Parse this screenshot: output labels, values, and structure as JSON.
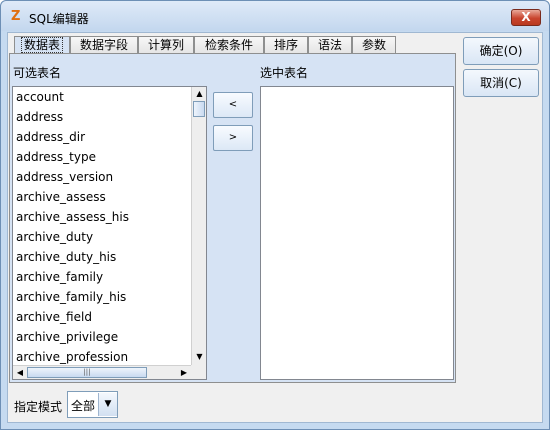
{
  "window": {
    "title": "SQL编辑器",
    "close_label": "X"
  },
  "tabs": [
    "数据表",
    "数据字段",
    "计算列",
    "检索条件",
    "排序",
    "语法",
    "参数"
  ],
  "available": {
    "label": "可选表名",
    "items": [
      "account",
      "address",
      "address_dir",
      "address_type",
      "address_version",
      "archive_assess",
      "archive_assess_his",
      "archive_duty",
      "archive_duty_his",
      "archive_family",
      "archive_family_his",
      "archive_field",
      "archive_privilege",
      "archive_profession"
    ]
  },
  "selected": {
    "label": "选中表名",
    "items": []
  },
  "move": {
    "left_label": "<",
    "right_label": ">"
  },
  "buttons": {
    "ok": "确定(O)",
    "cancel": "取消(C)"
  },
  "mode": {
    "label": "指定模式",
    "value": "全部"
  }
}
